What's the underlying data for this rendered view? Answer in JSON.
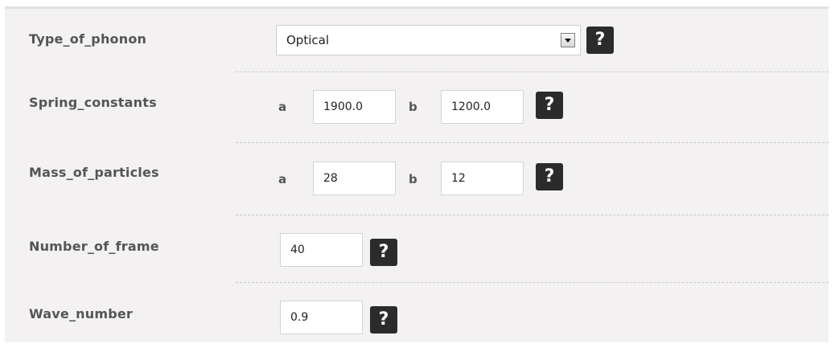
{
  "form": {
    "type_of_phonon": {
      "label": "Type_of_phonon",
      "selected": "Optical",
      "help": "?"
    },
    "spring_constants": {
      "label": "Spring_constants",
      "a_label": "a",
      "a_value": "1900.0",
      "b_label": "b",
      "b_value": "1200.0",
      "help": "?"
    },
    "mass_of_particles": {
      "label": "Mass_of_particles",
      "a_label": "a",
      "a_value": "28",
      "b_label": "b",
      "b_value": "12",
      "help": "?"
    },
    "number_of_frame": {
      "label": "Number_of_frame",
      "value": "40",
      "help": "?"
    },
    "wave_number": {
      "label": "Wave_number",
      "value": "0.9",
      "help": "?"
    }
  },
  "colors": {
    "panel_background": "#f3f1f2",
    "label_text": "#555555",
    "help_button": "#2b2b2b"
  }
}
